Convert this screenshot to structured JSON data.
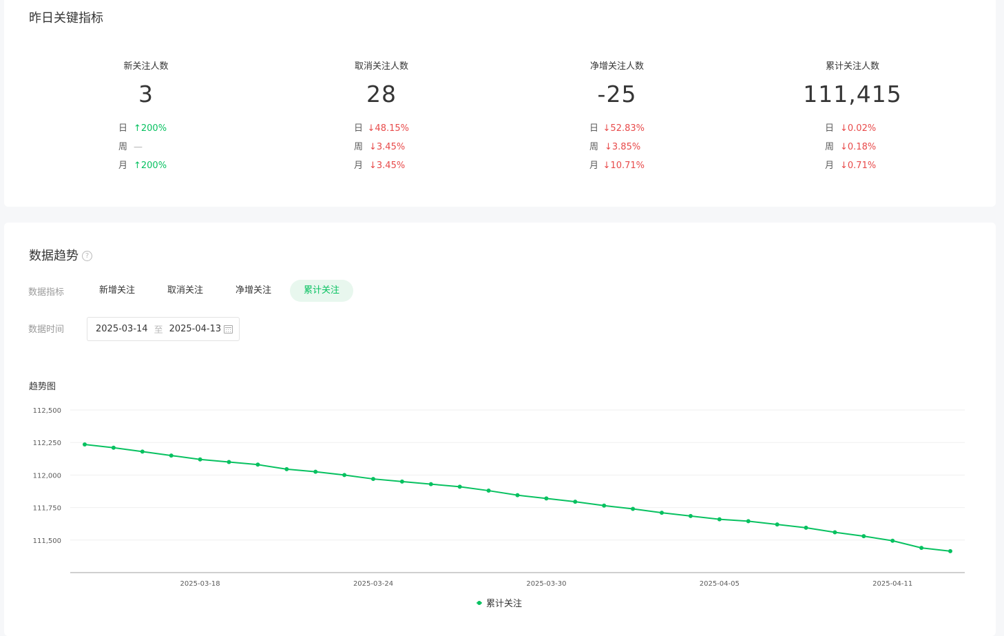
{
  "kpi": {
    "title": "昨日关键指标",
    "metrics": [
      {
        "label": "新关注人数",
        "value": "3",
        "rows": [
          {
            "key": "日",
            "arrow": "↑",
            "text": "200%",
            "trend": "up"
          },
          {
            "key": "周",
            "arrow": "",
            "text": "—",
            "trend": "flat"
          },
          {
            "key": "月",
            "arrow": "↑",
            "text": "200%",
            "trend": "up"
          }
        ]
      },
      {
        "label": "取消关注人数",
        "value": "28",
        "rows": [
          {
            "key": "日",
            "arrow": "↓",
            "text": "48.15%",
            "trend": "down"
          },
          {
            "key": "周",
            "arrow": "↓",
            "text": "3.45%",
            "trend": "down"
          },
          {
            "key": "月",
            "arrow": "↓",
            "text": "3.45%",
            "trend": "down"
          }
        ]
      },
      {
        "label": "净增关注人数",
        "value": "-25",
        "rows": [
          {
            "key": "日",
            "arrow": "↓",
            "text": "52.83%",
            "trend": "down"
          },
          {
            "key": "周",
            "arrow": "↓",
            "text": "3.85%",
            "trend": "down"
          },
          {
            "key": "月",
            "arrow": "↓",
            "text": "10.71%",
            "trend": "down"
          }
        ]
      },
      {
        "label": "累计关注人数",
        "value": "111,415",
        "rows": [
          {
            "key": "日",
            "arrow": "↓",
            "text": "0.02%",
            "trend": "down"
          },
          {
            "key": "周",
            "arrow": "↓",
            "text": "0.18%",
            "trend": "down"
          },
          {
            "key": "月",
            "arrow": "↓",
            "text": "0.71%",
            "trend": "down"
          }
        ]
      }
    ]
  },
  "trend": {
    "title": "数据趋势",
    "help_icon": "question-circle-icon",
    "help_glyph": "?",
    "metric_label": "数据指标",
    "tabs": [
      {
        "label": "新增关注",
        "active": false
      },
      {
        "label": "取消关注",
        "active": false
      },
      {
        "label": "净增关注",
        "active": false
      },
      {
        "label": "累计关注",
        "active": true
      }
    ],
    "time_label": "数据时间",
    "date_start": "2025-03-14",
    "date_separator": "至",
    "date_end": "2025-04-13",
    "calendar_icon": "calendar-icon",
    "chart_title": "趋势图"
  },
  "colors": {
    "accent": "#07c160",
    "down": "#e84a4a",
    "tab_active_bg": "#e8f7ee"
  },
  "chart_data": {
    "type": "line",
    "title": "",
    "xlabel": "",
    "ylabel": "",
    "x": [
      "2025-03-14",
      "2025-03-15",
      "2025-03-16",
      "2025-03-17",
      "2025-03-18",
      "2025-03-19",
      "2025-03-20",
      "2025-03-21",
      "2025-03-22",
      "2025-03-23",
      "2025-03-24",
      "2025-03-25",
      "2025-03-26",
      "2025-03-27",
      "2025-03-28",
      "2025-03-29",
      "2025-03-30",
      "2025-03-31",
      "2025-04-01",
      "2025-04-02",
      "2025-04-03",
      "2025-04-04",
      "2025-04-05",
      "2025-04-06",
      "2025-04-07",
      "2025-04-08",
      "2025-04-09",
      "2025-04-10",
      "2025-04-11",
      "2025-04-12",
      "2025-04-13"
    ],
    "x_tick_labels": [
      "2025-03-18",
      "2025-03-24",
      "2025-03-30",
      "2025-04-05",
      "2025-04-11"
    ],
    "series": [
      {
        "name": "累计关注",
        "color": "#07c160",
        "values": [
          112235,
          112210,
          112180,
          112150,
          112120,
          112100,
          112080,
          112045,
          112025,
          112000,
          111970,
          111950,
          111930,
          111910,
          111880,
          111845,
          111820,
          111795,
          111765,
          111740,
          111710,
          111685,
          111660,
          111645,
          111620,
          111595,
          111560,
          111530,
          111495,
          111440,
          111415
        ]
      }
    ],
    "y_ticks": [
      111500,
      111750,
      112000,
      112250,
      112500
    ],
    "y_tick_labels": [
      "111,500",
      "111,750",
      "112,000",
      "112,250",
      "112,500"
    ],
    "ylim": [
      111250,
      112500
    ],
    "grid": true,
    "legend_position": "bottom-center"
  }
}
